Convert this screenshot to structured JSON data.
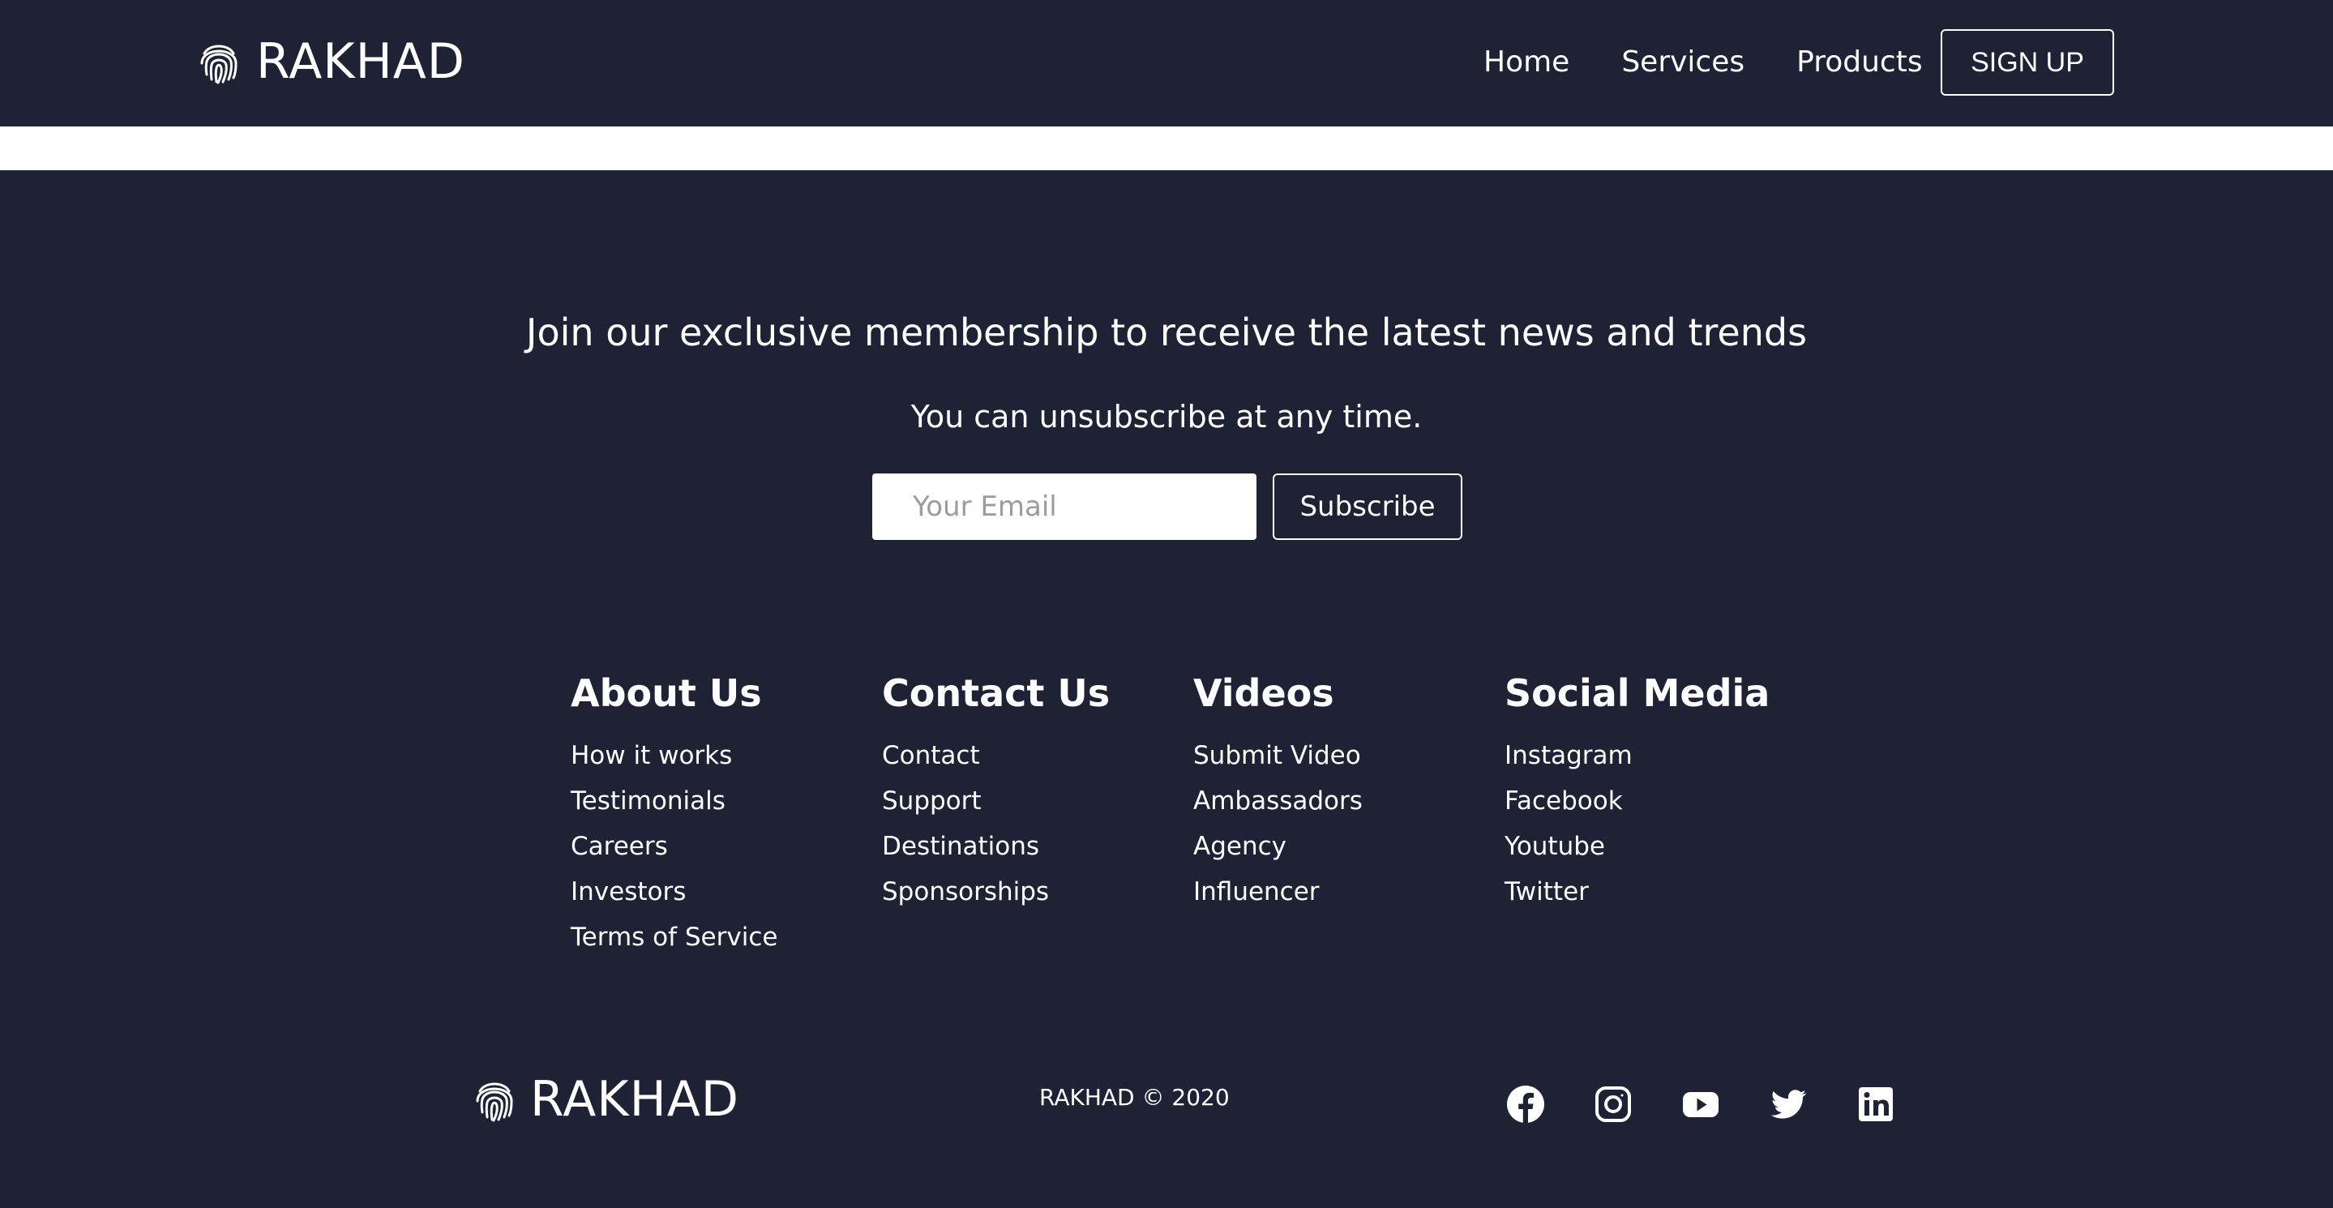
{
  "brand": {
    "name": "RAKHAD",
    "logo_icon": "fingerprint-icon"
  },
  "nav": {
    "links": [
      "Home",
      "Services",
      "Products"
    ],
    "signup_label": "SIGN UP"
  },
  "newsletter": {
    "heading": "Join our exclusive membership to receive the latest news and trends",
    "subheading": "You can unsubscribe at any time.",
    "email_placeholder": "Your Email",
    "subscribe_label": "Subscribe"
  },
  "footer_columns": [
    {
      "title": "About Us",
      "items": [
        "How it works",
        "Testimonials",
        "Careers",
        "Investors",
        "Terms of Service"
      ]
    },
    {
      "title": "Contact Us",
      "items": [
        "Contact",
        "Support",
        "Destinations",
        "Sponsorships"
      ]
    },
    {
      "title": "Videos",
      "items": [
        "Submit Video",
        "Ambassadors",
        "Agency",
        "Influencer"
      ]
    },
    {
      "title": "Social Media",
      "items": [
        "Instagram",
        "Facebook",
        "Youtube",
        "Twitter"
      ]
    }
  ],
  "footer": {
    "copyright": "RAKHAD © 2020",
    "social_icons": [
      "facebook-icon",
      "instagram-icon",
      "youtube-icon",
      "twitter-icon",
      "linkedin-icon"
    ]
  },
  "colors": {
    "background": "#1f2235",
    "text": "#ffffff",
    "strip": "#ffffff"
  }
}
